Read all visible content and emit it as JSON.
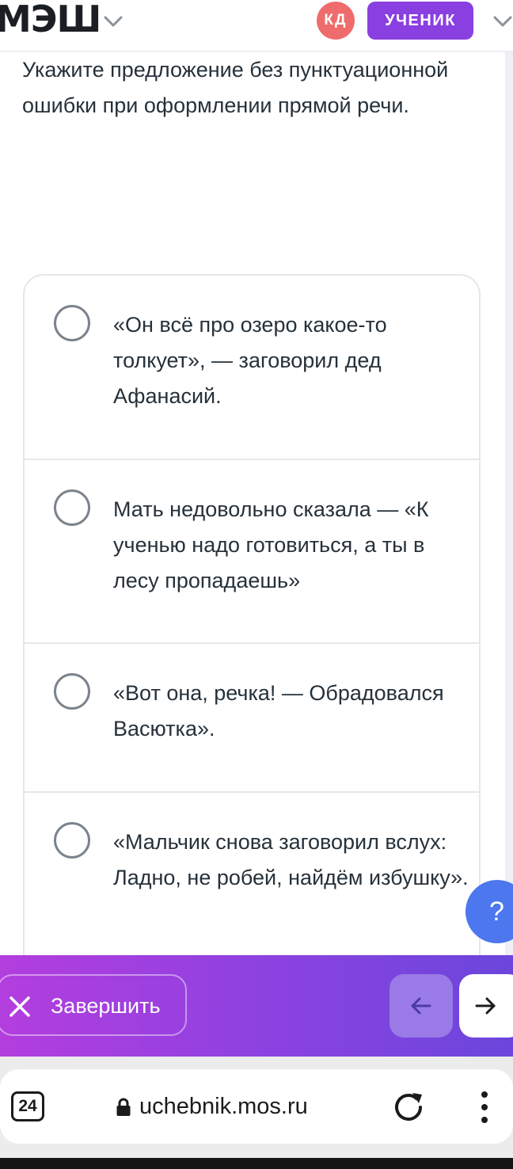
{
  "header": {
    "logo_text": "МЭШ",
    "avatar_initials": "КД",
    "role_label": "УЧЕНИК",
    "logo_chevron_icon": "chevron-down-icon",
    "role_chevron_icon": "chevron-down-icon"
  },
  "question": {
    "text": "Укажите предложение без пунктуационной ошибки при оформлении прямой речи."
  },
  "options": [
    {
      "text": "«Он всё про озеро какое-то толкует», — заговорил дед Афанасий.",
      "selected": false
    },
    {
      "text": "Мать недовольно сказала — «К ученью надо готовиться, а ты в лесу пропадаешь»",
      "selected": false
    },
    {
      "text": "«Вот она, речка! — Обрадовался Васютка».",
      "selected": false
    },
    {
      "text": "«Мальчик снова заговорил вслух: Ладно, не робей, найдём избушку».",
      "selected": false
    }
  ],
  "help": {
    "label": "?"
  },
  "action_bar": {
    "finish_label": "Завершить",
    "finish_icon": "close-icon",
    "prev_icon": "arrow-left-icon",
    "next_icon": "arrow-right-icon"
  },
  "browser": {
    "tabs_count": "24",
    "url": "uchebnik.mos.ru",
    "lock_icon": "lock-icon",
    "reload_icon": "reload-icon",
    "menu_icon": "more-vertical-icon"
  },
  "colors": {
    "accent_purple": "#8a3fe0",
    "avatar_red": "#ef6c6c",
    "help_blue": "#4c77ee",
    "gradient_start": "#b33ede",
    "gradient_end": "#6b46dc"
  }
}
